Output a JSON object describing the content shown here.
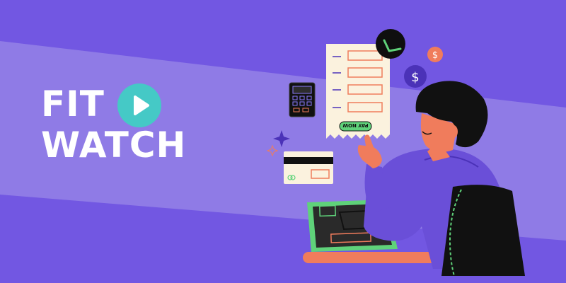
{
  "banner": {
    "title_line1": "FIT",
    "title_line2": "WATCH"
  },
  "receipt": {
    "pay_label": "PAY NOW"
  },
  "badges": {
    "check_symbol": "✓",
    "dollar_symbol": "$"
  },
  "colors": {
    "background": "#7257e2",
    "band": "#8f7be6",
    "play_button": "#45c9c6",
    "accent_green": "#5fd27a",
    "accent_orange": "#f07c5c",
    "hoodie": "#6a4fd8"
  },
  "icons": [
    "play-icon",
    "checkmark-icon",
    "dollar-icon",
    "calculator-icon",
    "credit-card-icon",
    "sparkle-icon",
    "laptop-icon",
    "chair-icon"
  ]
}
